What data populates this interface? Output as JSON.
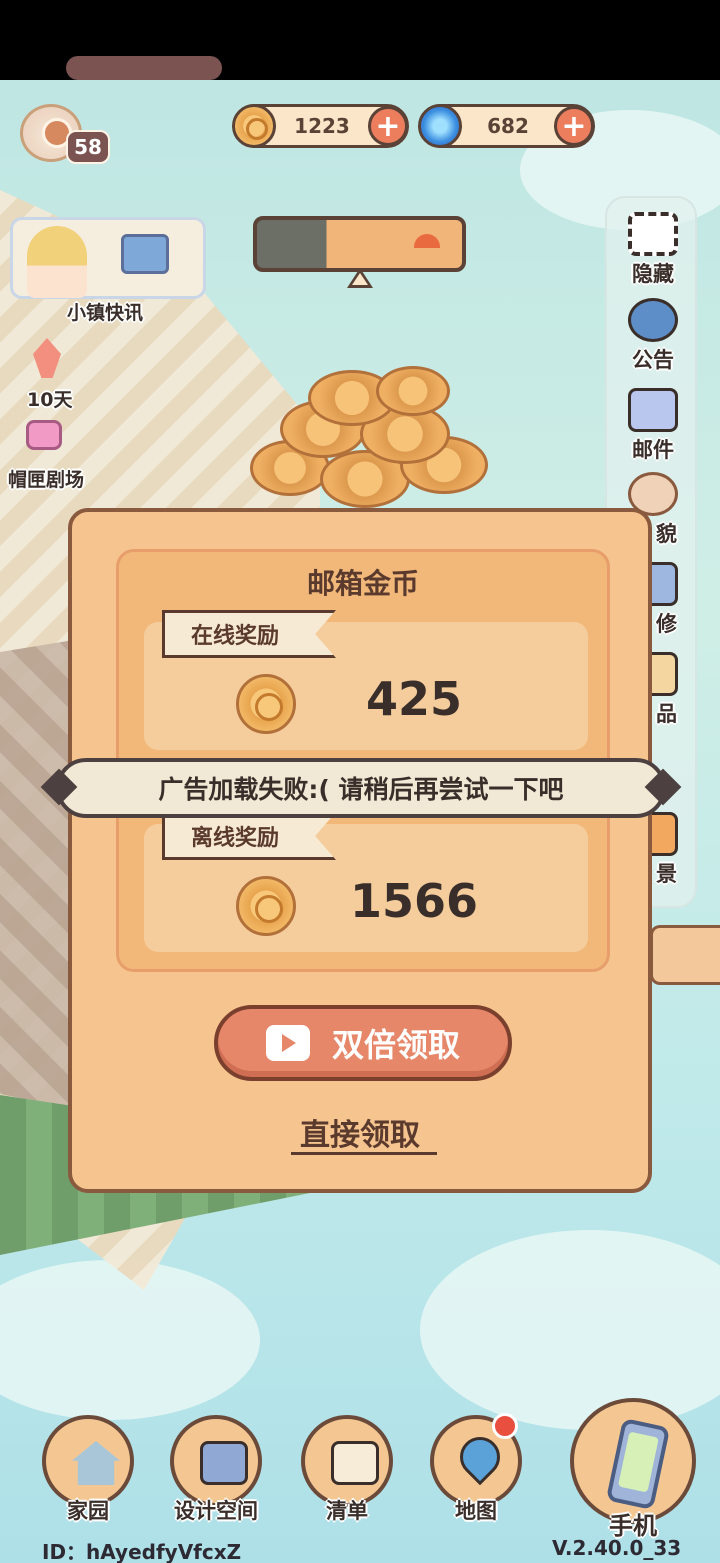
{
  "status_bar": {},
  "player": {
    "level": "58"
  },
  "currencies": {
    "coins": "1223",
    "gems": "682",
    "add_coins_symbol": "+",
    "add_gems_symbol": "+"
  },
  "left_menu": {
    "news_label": "小镇快讯",
    "event_days_label": "10天",
    "theater_label": "帽匣剧场"
  },
  "right_menu": {
    "items": [
      {
        "label": "隐藏",
        "icon": "hide-frame-icon"
      },
      {
        "label": "公告",
        "icon": "megaphone-icon"
      },
      {
        "label": "邮件",
        "icon": "mail-icon"
      },
      {
        "label": "貌",
        "icon": "character-icon"
      },
      {
        "label": "修",
        "icon": "wrench-icon"
      },
      {
        "label": "品",
        "icon": "items-icon"
      },
      {
        "label": "景",
        "icon": "scenery-icon"
      }
    ]
  },
  "modal": {
    "title": "邮箱金币",
    "online_reward": {
      "label": "在线奖励",
      "value": "425"
    },
    "offline_reward": {
      "label": "离线奖励",
      "value": "1566"
    },
    "double_button_label": "双倍领取",
    "direct_claim_label": "直接领取"
  },
  "toast": {
    "message": "广告加载失败:( 请稍后再尝试一下吧"
  },
  "bottom_nav": {
    "home": "家园",
    "design_space": "设计空间",
    "list": "清单",
    "map": "地图",
    "phone": "手机"
  },
  "footer": {
    "player_id": "ID：hAyedfyVfcxZ",
    "version": "V.2.40.0_33"
  },
  "colors": {
    "panel": "#f6c48e",
    "panel_border": "#8a5a3e",
    "button_accent": "#e7876a",
    "sky": "#bfe6e3"
  }
}
